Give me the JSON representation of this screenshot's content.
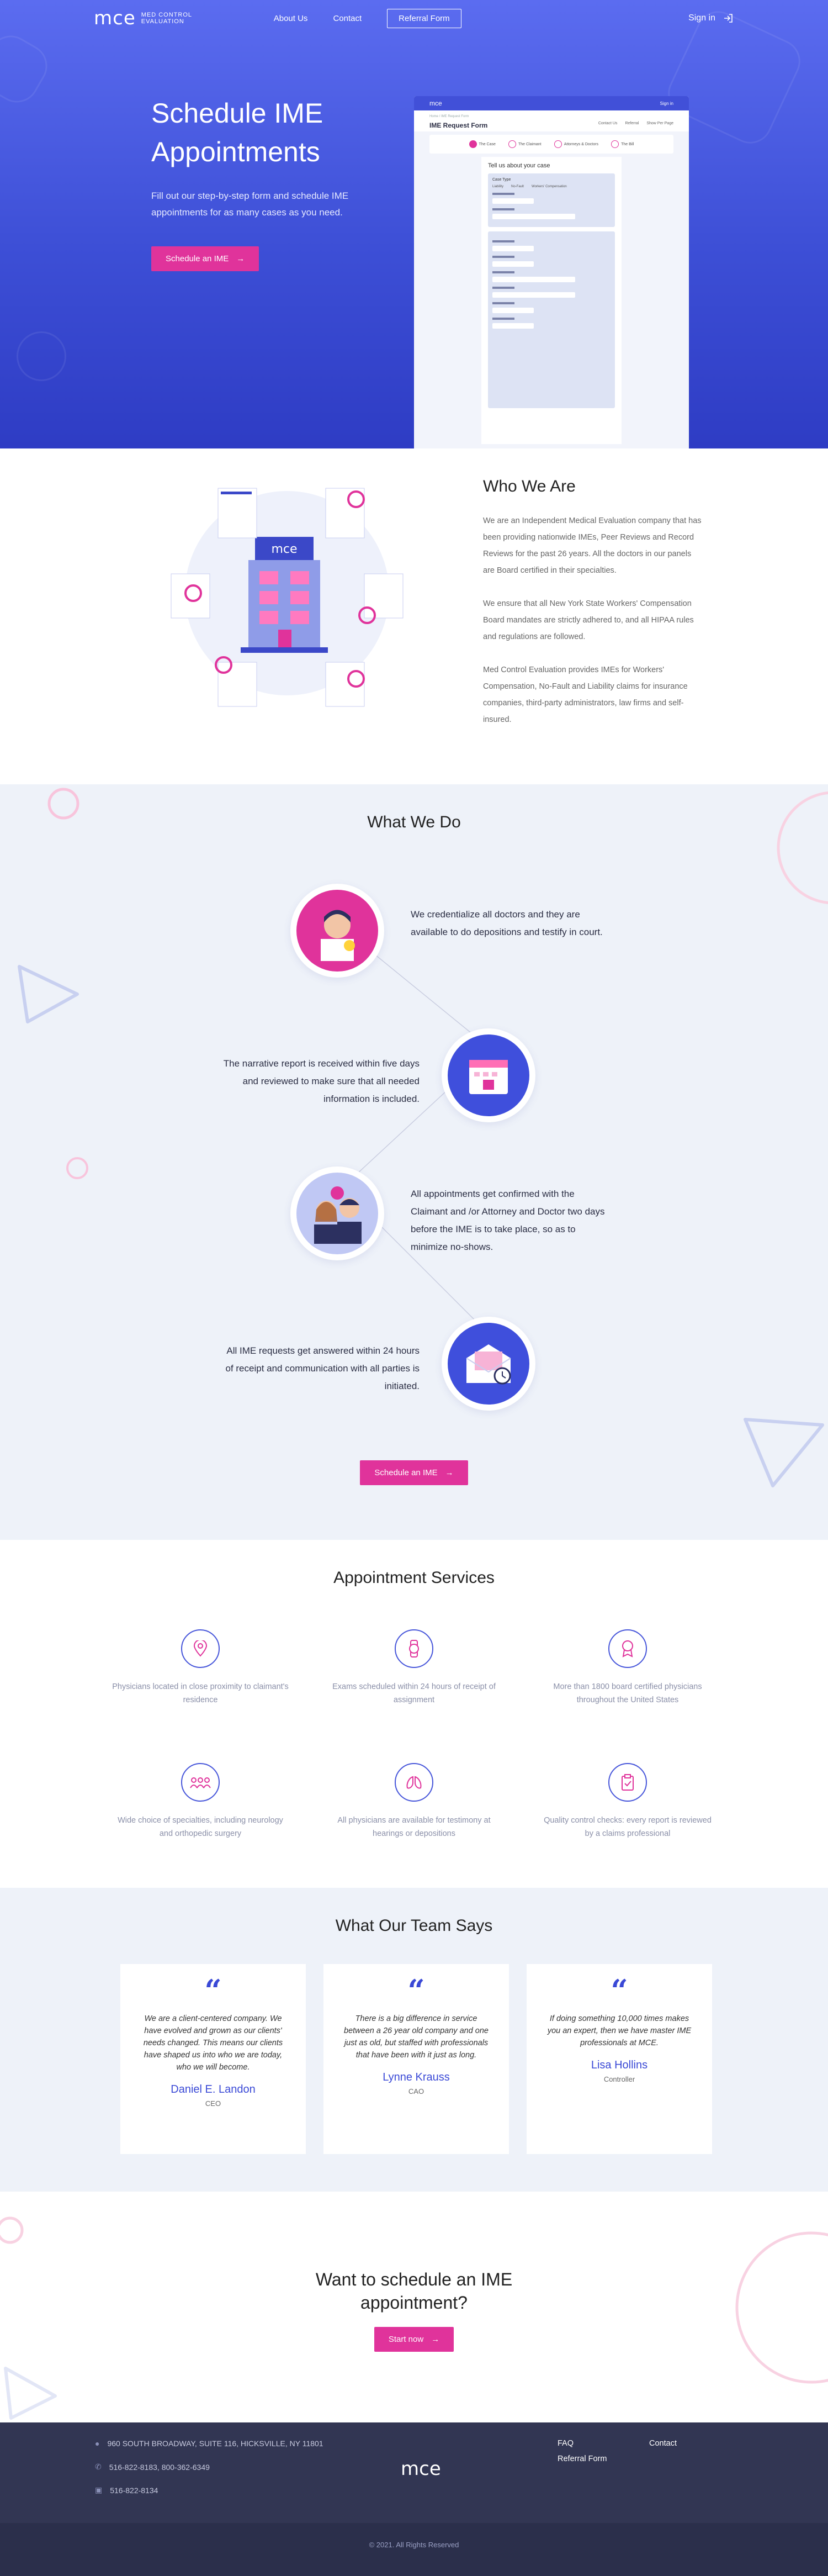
{
  "nav": {
    "logo_mark": "mce",
    "logo_line1": "MED CONTROL",
    "logo_line2": "EVALUATION",
    "about": "About Us",
    "contact": "Contact",
    "referral": "Referral Form",
    "signin": "Sign in"
  },
  "hero": {
    "title_line1": "Schedule IME",
    "title_line2": "Appointments",
    "subtitle": "Fill out our step-by-step form and schedule IME appointments for as many cases as you need.",
    "cta": "Schedule an IME"
  },
  "mockup": {
    "bar_logo": "mce",
    "bar_signin": "Sign in",
    "crumb": "Home / IME Request Form",
    "form_title": "IME Request Form",
    "header_links": [
      "Contact Us",
      "Referral",
      "Show Per Page"
    ],
    "steps": [
      "The Case",
      "The Claimant",
      "Attorneys & Doctors",
      "The Bill"
    ],
    "question": "Tell us about your case",
    "case_type": "Case Type",
    "case_options": [
      "Liability",
      "No-Fault",
      "Workers' Compensation"
    ]
  },
  "who": {
    "title": "Who We Are",
    "p1": "We are an Independent Medical Evaluation company that has been providing nationwide IMEs, Peer Reviews and Record Reviews for the past 26 years. All the doctors in our panels are Board certified in their specialties.",
    "p2": "We ensure that all New York State Workers' Compensation Board mandates are strictly adhered to, and all HIPAA rules and regulations are followed.",
    "p3": "Med Control Evaluation provides IMEs for Workers' Compensation, No-Fault and Liability claims for insurance companies, third-party administrators, law firms and self-insured.",
    "building_logo": "mce"
  },
  "what": {
    "title": "What We Do",
    "steps": [
      "We credentialize all doctors and they are available to do depositions and testify in court.",
      "The narrative report is received within five days and reviewed to make sure that all needed information is included.",
      "All appointments get confirmed with the Claimant and /or Attorney and Doctor two days before the IME is to take place, so as to minimize no-shows.",
      "All IME requests get answered within 24 hours of receipt and communication with all parties is initiated."
    ],
    "cta": "Schedule an IME"
  },
  "services": {
    "title": "Appointment Services",
    "items": [
      {
        "icon": "location-pin-icon",
        "text": "Physicians located in close proximity to claimant's residence"
      },
      {
        "icon": "watch-icon",
        "text": "Exams scheduled within 24 hours of receipt of assignment"
      },
      {
        "icon": "award-medal-icon",
        "text": "More than 1800 board certified physicians throughout the United States"
      },
      {
        "icon": "group-icon",
        "text": "Wide choice of specialties, including neurology and orthopedic surgery"
      },
      {
        "icon": "lungs-icon",
        "text": "All physicians are available for testimony at hearings or depositions"
      },
      {
        "icon": "clipboard-check-icon",
        "text": "Quality control checks: every report is reviewed by a claims professional"
      }
    ]
  },
  "team": {
    "title": "What Our Team Says",
    "testimonials": [
      {
        "quote": "We are a client-centered company. We have evolved and grown as our clients' needs changed. This means our clients have shaped us into who we are today, who we will become.",
        "name": "Daniel E. Landon",
        "role": "CEO"
      },
      {
        "quote": "There is a big difference in service between a 26 year old company and one just as old, but staffed with professionals that have been with it just as long.",
        "name": "Lynne Krauss",
        "role": "CAO"
      },
      {
        "quote": "If doing something 10,000 times makes you an expert, then we have master IME professionals at MCE.",
        "name": "Lisa Hollins",
        "role": "Controller"
      }
    ]
  },
  "cta": {
    "title_line1": "Want to schedule an IME",
    "title_line2": "appointment?",
    "button": "Start now"
  },
  "footer": {
    "address": "960 SOUTH BROADWAY, SUITE 116, HICKSVILLE, NY 11801",
    "phones": "516-822-8183, 800-362-6349",
    "fax": "516-822-8134",
    "logo": "mce",
    "faq": "FAQ",
    "contact": "Contact",
    "referral": "Referral Form",
    "copyright": "© 2021. All Rights Reserved"
  },
  "colors": {
    "primary": "#4150d8",
    "accent": "#e0339b",
    "footer": "#323653"
  }
}
